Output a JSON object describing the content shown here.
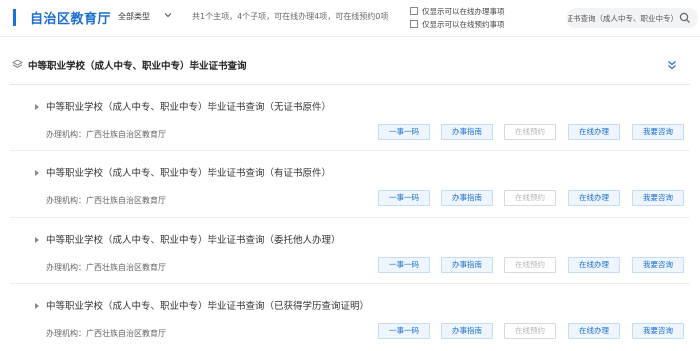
{
  "header": {
    "department": "自治区教育厅",
    "type_filter": "全部类型",
    "summary": "共1个主项，4个子项，可在线办理4项，可在线预约0项",
    "filters": [
      {
        "label": "仅显示可以在线办理事项",
        "checked": false
      },
      {
        "label": "仅显示可以在线预约事项",
        "checked": false
      }
    ],
    "search_value": "（成人中专、职业中专）毕业证书查询"
  },
  "group": {
    "title": "中等职业学校（成人中专、职业中专）毕业证书查询"
  },
  "items": [
    {
      "name": "中等职业学校（成人中专、职业中专）毕业证书查询（无证书原件）",
      "org": "办理机构：广西壮族自治区教育厅",
      "buttons": [
        {
          "label": "一事一码",
          "disabled": false
        },
        {
          "label": "办事指南",
          "disabled": false
        },
        {
          "label": "在线预约",
          "disabled": true
        },
        {
          "label": "在线办理",
          "disabled": false
        },
        {
          "label": "我要咨询",
          "disabled": false
        }
      ]
    },
    {
      "name": "中等职业学校（成人中专、职业中专）毕业证书查询（有证书原件）",
      "org": "办理机构：广西壮族自治区教育厅",
      "buttons": [
        {
          "label": "一事一码",
          "disabled": false
        },
        {
          "label": "办事指南",
          "disabled": false
        },
        {
          "label": "在线预约",
          "disabled": true
        },
        {
          "label": "在线办理",
          "disabled": false
        },
        {
          "label": "我要咨询",
          "disabled": false
        }
      ]
    },
    {
      "name": "中等职业学校（成人中专、职业中专）毕业证书查询（委托他人办理）",
      "org": "办理机构：广西壮族自治区教育厅",
      "buttons": [
        {
          "label": "一事一码",
          "disabled": false
        },
        {
          "label": "办事指南",
          "disabled": false
        },
        {
          "label": "在线预约",
          "disabled": true
        },
        {
          "label": "在线办理",
          "disabled": false
        },
        {
          "label": "我要咨询",
          "disabled": false
        }
      ]
    },
    {
      "name": "中等职业学校（成人中专、职业中专）毕业证书查询（已获得学历查询证明）",
      "org": "办理机构：广西壮族自治区教育厅",
      "buttons": [
        {
          "label": "一事一码",
          "disabled": false
        },
        {
          "label": "办事指南",
          "disabled": false
        },
        {
          "label": "在线预约",
          "disabled": true
        },
        {
          "label": "在线办理",
          "disabled": false
        },
        {
          "label": "我要咨询",
          "disabled": false
        }
      ]
    }
  ],
  "colors": {
    "accent": "#1a6fd0",
    "button_bg": "#eef5fd",
    "button_border": "#c4dcf5",
    "disabled_text": "#b5b5b5"
  },
  "icons": [
    "layers-icon",
    "chevron-down-icon",
    "checkbox-icon",
    "search-icon",
    "collapse-double-chevron-icon",
    "triangle-bullet-icon"
  ]
}
